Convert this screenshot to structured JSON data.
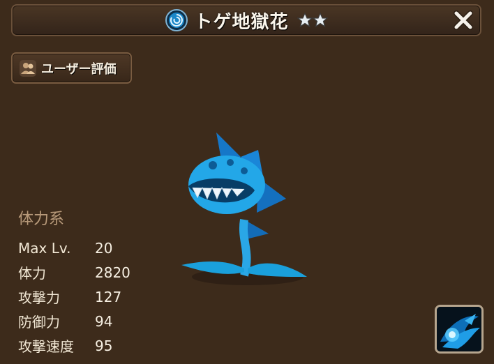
{
  "header": {
    "monster_name": "トゲ地獄花",
    "element_icon": "water-element-icon",
    "star_count": 2,
    "close_icon": "close-icon"
  },
  "review_button": {
    "label": "ユーザー評価",
    "icon": "users-icon"
  },
  "stats": {
    "category": "体力系",
    "rows": [
      {
        "label": "Max Lv.",
        "value": "20"
      },
      {
        "label": "体力",
        "value": "2820"
      },
      {
        "label": "攻撃力",
        "value": "127"
      },
      {
        "label": "防御力",
        "value": "94"
      },
      {
        "label": "攻撃速度",
        "value": "95"
      }
    ]
  },
  "skill": {
    "icon": "water-skill-icon"
  },
  "colors": {
    "background": "#3d2b1b",
    "panel_border": "#6b513a",
    "category_text": "#b89a7a",
    "monster_blue": "#1e9be0"
  }
}
